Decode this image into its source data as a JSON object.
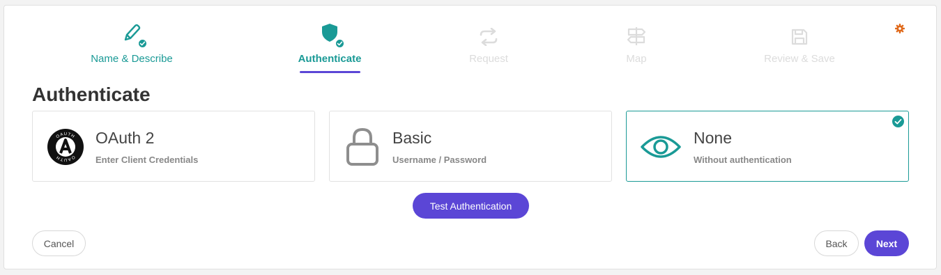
{
  "colors": {
    "accent": "#5b46d6",
    "teal": "#1a9a96",
    "muted": "#dcdcdc",
    "gear": "#e06a1b"
  },
  "steps": [
    {
      "label": "Name & Describe",
      "icon": "pencil-icon",
      "state": "done"
    },
    {
      "label": "Authenticate",
      "icon": "shield-icon",
      "state": "active"
    },
    {
      "label": "Request",
      "icon": "swap-arrows-icon",
      "state": "pending"
    },
    {
      "label": "Map",
      "icon": "signpost-icon",
      "state": "pending"
    },
    {
      "label": "Review & Save",
      "icon": "save-icon",
      "state": "pending"
    }
  ],
  "settings_icon": "gear-icon",
  "page_title": "Authenticate",
  "auth_options": [
    {
      "title": "OAuth 2",
      "subtitle": "Enter Client Credentials",
      "icon": "oauth-logo-icon",
      "selected": false,
      "logo_ring_text": "OAUTH"
    },
    {
      "title": "Basic",
      "subtitle": "Username / Password",
      "icon": "lock-icon",
      "selected": false
    },
    {
      "title": "None",
      "subtitle": "Without authentication",
      "icon": "eye-icon",
      "selected": true
    }
  ],
  "buttons": {
    "test": "Test Authentication",
    "cancel": "Cancel",
    "back": "Back",
    "next": "Next"
  }
}
